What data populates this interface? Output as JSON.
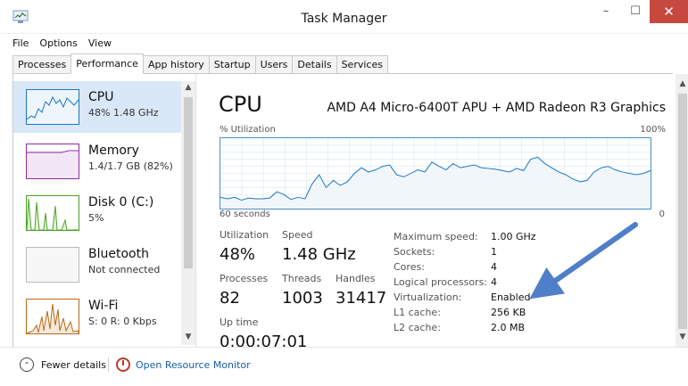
{
  "window": {
    "title": "Task Manager",
    "minimize": "–",
    "maximize": "☐",
    "close": "✕"
  },
  "menu": [
    "File",
    "Options",
    "View"
  ],
  "tabs": [
    "Processes",
    "Performance",
    "App history",
    "Startup",
    "Users",
    "Details",
    "Services"
  ],
  "active_tab": "Performance",
  "sidebar": {
    "items": [
      {
        "name": "CPU",
        "detail": "48% 1.48 GHz",
        "color": "#1a76c7"
      },
      {
        "name": "Memory",
        "detail": "1.4/1.7 GB (82%)",
        "color": "#8b2ca2"
      },
      {
        "name": "Disk 0 (C:)",
        "detail": "5%",
        "color": "#4ba227"
      },
      {
        "name": "Bluetooth",
        "detail": "Not connected",
        "color": "#999999"
      },
      {
        "name": "Wi-Fi",
        "detail": "S: 0 R: 0 Kbps",
        "color": "#b86a17"
      }
    ]
  },
  "cpu": {
    "title": "CPU",
    "model": "AMD A4 Micro-6400T APU + AMD Radeon R3 Graphics",
    "util_label": "% Utilization",
    "util_max": "100%",
    "time_label": "60 seconds",
    "time_zero": "0",
    "graph_color": "#1a76c7",
    "graph_values": [
      16,
      14,
      16,
      12,
      15,
      14,
      14,
      15,
      24,
      20,
      13,
      16,
      14,
      35,
      48,
      30,
      40,
      33,
      38,
      50,
      58,
      52,
      55,
      60,
      62,
      48,
      45,
      50,
      55,
      52,
      66,
      60,
      55,
      64,
      58,
      60,
      62,
      58,
      57,
      56,
      54,
      52,
      57,
      54,
      70,
      73,
      64,
      58,
      52,
      48,
      42,
      38,
      40,
      52,
      58,
      60,
      55,
      52,
      50,
      48,
      50,
      54
    ],
    "utilization": {
      "label": "Utilization",
      "value": "48%"
    },
    "speed": {
      "label": "Speed",
      "value": "1.48 GHz"
    },
    "processes": {
      "label": "Processes",
      "value": "82"
    },
    "threads": {
      "label": "Threads",
      "value": "1003"
    },
    "handles": {
      "label": "Handles",
      "value": "31417"
    },
    "uptime": {
      "label": "Up time",
      "value": "0:00:07:01"
    },
    "details": [
      {
        "key": "Maximum speed:",
        "value": "1.00 GHz"
      },
      {
        "key": "Sockets:",
        "value": "1"
      },
      {
        "key": "Cores:",
        "value": "4"
      },
      {
        "key": "Logical processors:",
        "value": "4"
      },
      {
        "key": "Virtualization:",
        "value": "Enabled"
      },
      {
        "key": "L1 cache:",
        "value": "256 KB"
      },
      {
        "key": "L2 cache:",
        "value": "2.0 MB"
      }
    ]
  },
  "footer": {
    "fewer_details": "Fewer details",
    "resource_monitor": "Open Resource Monitor"
  },
  "annotation_arrow_color": "#4f7fc8"
}
